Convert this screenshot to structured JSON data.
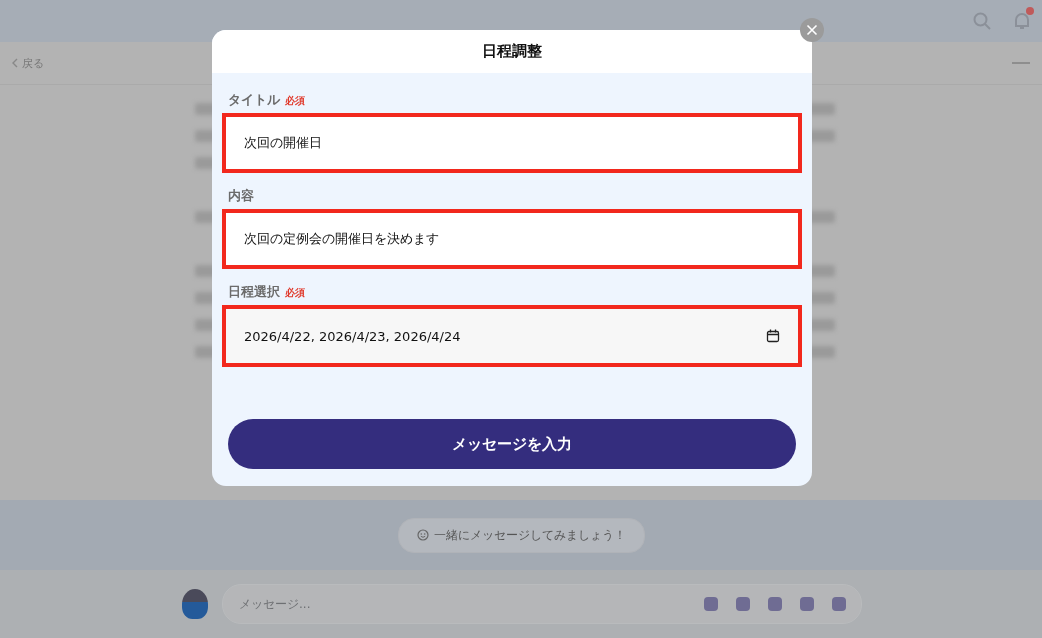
{
  "header": {
    "has_notification": true
  },
  "nav": {
    "back_label": "戻る"
  },
  "banner": {
    "text": "一緒にメッセージしてみましょう！"
  },
  "composer": {
    "placeholder": "メッセージ..."
  },
  "modal": {
    "title": "日程調整",
    "fields": [
      {
        "kind": "text",
        "label": "タイトル",
        "required_label": "必須",
        "value": "次回の開催日",
        "highlighted": true
      },
      {
        "kind": "text",
        "label": "内容",
        "value": "次回の定例会の開催日を決めます",
        "highlighted": true
      },
      {
        "kind": "date",
        "label": "日程選択",
        "required_label": "必須",
        "value": "2026/4/22, 2026/4/23, 2026/4/24",
        "highlighted": true
      }
    ],
    "submit_button": "メッセージを入力"
  }
}
